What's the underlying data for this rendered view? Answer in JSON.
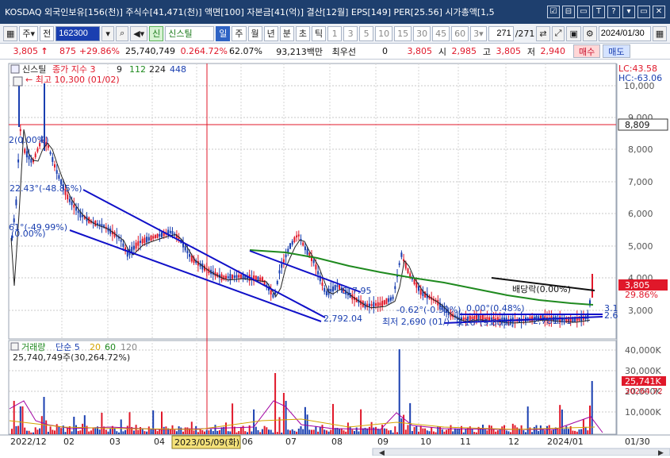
{
  "window": {
    "title": "KOSDAQ 외국인보유[156(천)] 주식수[41,471(천)] 액면[100] 자본금[41(억)] 결산[12월] EPS[149] PER[25.56] 시가총액[1,5",
    "buttons": [
      "☑",
      "⊟",
      "▭",
      "T",
      "?",
      "▾",
      "▭",
      "✕"
    ]
  },
  "toolbar": {
    "type_select": "주",
    "prev_label": "전",
    "stock_code": "162300",
    "stock_name": "신스틸",
    "periods": [
      "일",
      "주",
      "월",
      "년",
      "분",
      "초",
      "틱"
    ],
    "active_period": "일",
    "minute_values": [
      "1",
      "3",
      "5",
      "10",
      "15",
      "30",
      "45",
      "60"
    ],
    "interval_value": "3",
    "count_value": "271",
    "count_total": "/271",
    "date_value": "2024/01/30"
  },
  "quote": {
    "price": "3,805",
    "change": "875",
    "change_pct": "+29.86%",
    "volume": "25,740,749",
    "turnover": "0.264.72%",
    "ratio": "62.07%",
    "amount": "93,213백만",
    "pref_label": "최우선",
    "pref_value": "0",
    "p2": "3,805",
    "open_label": "시",
    "open": "2,985",
    "high_label": "고",
    "high": "3,805",
    "low_label": "저",
    "low": "2,940",
    "buy_label": "매수",
    "sell_label": "매도"
  },
  "chart": {
    "legend_name": "신스틸",
    "legend_indicator": "종가 지수 3",
    "legend_mas": [
      "9",
      "112",
      "224",
      "448"
    ],
    "max_label": "최고 10,300 (01/02)",
    "lc_label": "LC:43.58",
    "hc_label": "HC:-63.06",
    "price_ticks": [
      "10,000",
      "9,000",
      "8,000",
      "7,000",
      "6,000",
      "5,000",
      "4,000",
      "3,000"
    ],
    "hline_value": "8,809",
    "current_value": "3,805",
    "current_pct": "29.86%",
    "ann_left1": "22.43°(-48.85%)",
    "ann_left2": "61°(-49.99%)",
    "ann_left3": "(0.00%)",
    "ann_top_left": "2(0.00%)",
    "ann_617": "617.95",
    "ann_2792": "2,792.04",
    "ann_062": "-0.62°(-0.53%)",
    "ann_000": "0.00°(0.48%)",
    "ann_min": "최저 2,690 (01/)",
    "ann_316": "3.16°(9.80%)",
    "ann_2781": "2,781.41",
    "ann_div": "배당락(0.00%)",
    "ann_31": "3.1",
    "ann_26": "2.6",
    "vol_legend": "거래량",
    "vol_ma_label": "단순 5",
    "vol_mas": [
      "20",
      "60",
      "120"
    ],
    "vol_info": "25,740,749주(30,264.72%)",
    "vol_ticks": [
      "40,000K",
      "30,000K",
      "20,000K",
      "10,000K"
    ],
    "vol_current": "25,741K",
    "vol_current_pct": "30264.72",
    "time_labels": [
      "2022/12",
      "02",
      "03",
      "04",
      "05",
      "06",
      "07",
      "08",
      "09",
      "10",
      "11",
      "12",
      "2024/01"
    ],
    "time_cursor": "2023/05/09(화)",
    "time_right": "01/30"
  },
  "colors": {
    "up": "#e0182a",
    "down": "#1a3fb0",
    "ma_green": "#1f8a1f",
    "channel": "#1010c8"
  }
}
